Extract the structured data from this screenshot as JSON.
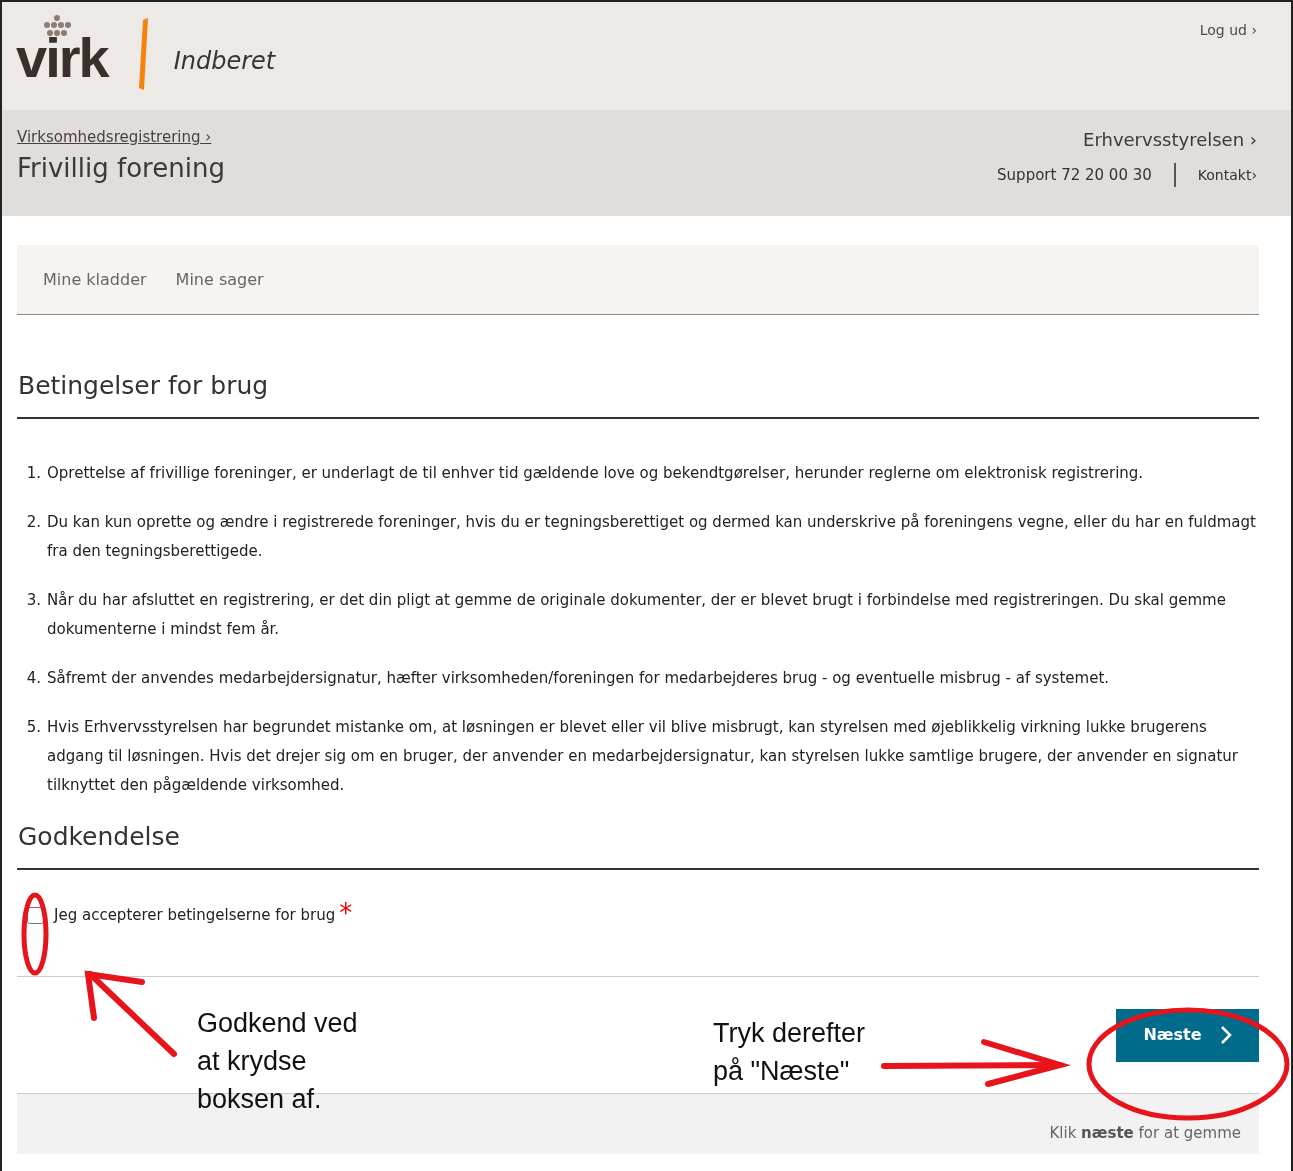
{
  "header": {
    "logo": "virk",
    "app_title": "Indberet",
    "logout": "Log ud ›"
  },
  "subheader": {
    "breadcrumb": "Virksomhedsregistrering ›",
    "title": "Frivillig forening",
    "org_link": "Erhvervsstyrelsen ›",
    "support": "Support 72 20 00 30",
    "contact": "Kontakt›"
  },
  "nav_tabs": [
    {
      "label": "Mine kladder",
      "selected": false
    },
    {
      "label": "Mine sager",
      "selected": false
    }
  ],
  "terms": {
    "heading": "Betingelser for brug",
    "items": [
      {
        "number": "1.",
        "text": "Oprettelse af frivillige foreninger, er underlagt de til enhver tid gældende love og bekendtgørelser, herunder reglerne om elektronisk registrering."
      },
      {
        "number": "2.",
        "text": "Du kan kun oprette og ændre i registrerede foreninger, hvis du er tegningsberettiget og dermed kan underskrive på foreningens vegne, eller du har en fuldmagt fra den tegningsberettigede."
      },
      {
        "number": "3.",
        "text": "Når du har afsluttet en registrering, er det din pligt at gemme de originale dokumenter, der er blevet brugt i forbindelse med registreringen. Du skal gemme dokumenterne i mindst fem år."
      },
      {
        "number": "4.",
        "text": "Såfremt der anvendes medarbejdersignatur, hæfter virksomheden/foreningen for medarbejderes brug - og eventuelle misbrug - af systemet."
      },
      {
        "number": "5.",
        "text": "Hvis Erhvervsstyrelsen har begrundet mistanke om, at løsningen er blevet eller vil blive misbrugt, kan styrelsen med øjeblikkelig virkning lukke brugerens adgang til løsningen. Hvis det drejer sig om en bruger, der anvender en medarbejdersignatur, kan styrelsen lukke samtlige brugere, der anvender en signatur tilknyttet den pågældende virksomhed."
      }
    ]
  },
  "approval": {
    "heading": "Godkendelse",
    "checkbox": {
      "label": "Jeg accepterer betingelserne for brug",
      "checked": false,
      "required_mark": "*"
    }
  },
  "next_button": "Næste",
  "footer_hint": "Klik **næste** for at gemme",
  "annotations": [
    {
      "text": "Godkend ved\nat krydse\nboksen af."
    },
    {
      "text": "Tryk derefter\npå \"Næste\""
    }
  ]
}
